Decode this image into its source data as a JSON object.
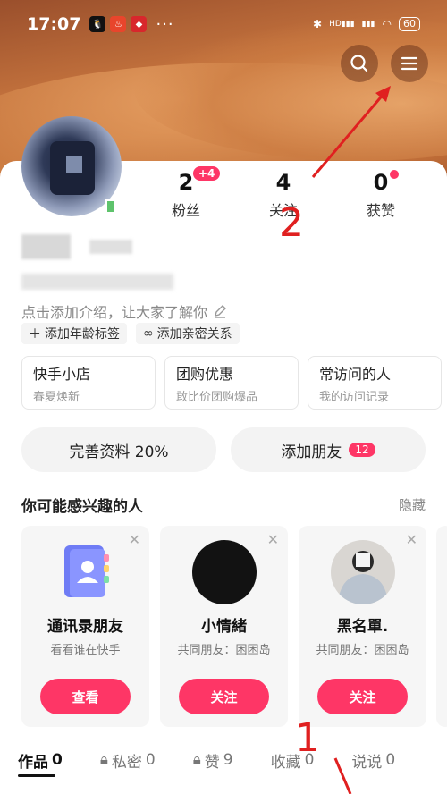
{
  "status_bar": {
    "time": "17:07",
    "dots": "···",
    "signal_label": "HD",
    "battery": "60"
  },
  "header": {
    "search_icon": "search-icon",
    "menu_icon": "menu-icon"
  },
  "stats": [
    {
      "value": "2",
      "label": "粉丝",
      "badge": "+4"
    },
    {
      "value": "4",
      "label": "关注"
    },
    {
      "value": "0",
      "label": "获赞",
      "dot": true
    }
  ],
  "profile": {
    "intro": "点击添加介绍，让大家了解你",
    "tags": [
      "添加年龄标签",
      "添加亲密关系"
    ]
  },
  "shortcuts": [
    {
      "title": "快手小店",
      "sub": "春夏焕新"
    },
    {
      "title": "团购优惠",
      "sub": "敢比价团购爆品"
    },
    {
      "title": "常访问的人",
      "sub": "我的访问记录"
    }
  ],
  "actions": {
    "complete_profile": "完善资料 20%",
    "add_friends": "添加朋友",
    "add_friends_count": "12"
  },
  "recommend": {
    "title": "你可能感兴趣的人",
    "hide": "隐藏",
    "cards": [
      {
        "name": "通讯录朋友",
        "sub": "看看谁在快手",
        "button": "查看"
      },
      {
        "name": "小情緒",
        "sub": "共同朋友：困困岛",
        "button": "关注"
      },
      {
        "name": "黑名單.",
        "sub": "共同朋友：困困岛",
        "button": "关注"
      }
    ]
  },
  "tabs": [
    {
      "label": "作品",
      "count": "0"
    },
    {
      "label": "私密",
      "count": "0"
    },
    {
      "label": "赞",
      "count": "9"
    },
    {
      "label": "收藏",
      "count": "0"
    },
    {
      "label": "说说",
      "count": "0"
    }
  ],
  "annotations": {
    "mark1": "1",
    "mark2": "2"
  },
  "colors": {
    "accent": "#fe3666",
    "annotation": "#e02020"
  }
}
